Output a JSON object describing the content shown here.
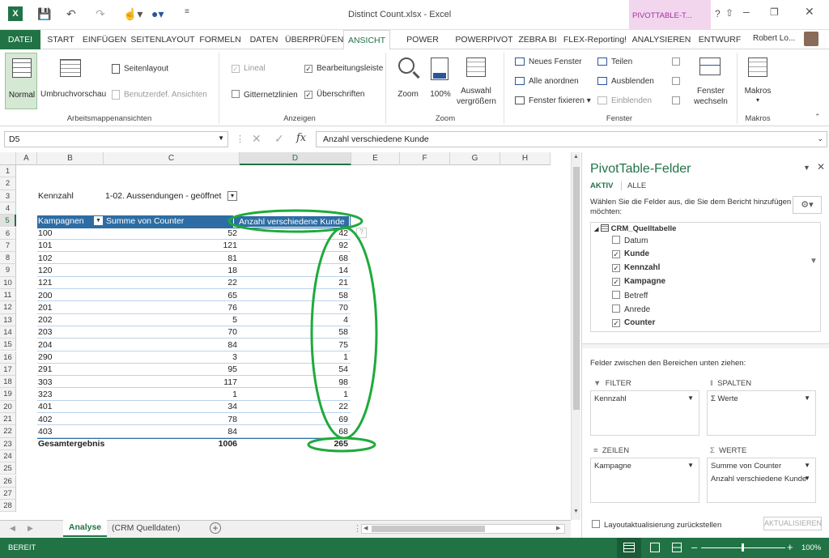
{
  "window": {
    "title": "Distinct Count.xlsx - Excel",
    "context_tab_title": "PIVOTTABLE-T...",
    "user": "Robert Lo..."
  },
  "tabs": [
    "DATEI",
    "START",
    "EINFÜGEN",
    "SEITENLAYOUT",
    "FORMELN",
    "DATEN",
    "ÜBERPRÜFEN",
    "ANSICHT",
    "POWER QUERY",
    "POWERPIVOT",
    "ZEBRA BI",
    "FLEX-Reporting!",
    "ANALYSIEREN",
    "ENTWURF"
  ],
  "ribbon": {
    "workbook_views": {
      "normal": "Normal",
      "page_break": "Umbruchvorschau",
      "page_layout": "Seitenlayout",
      "custom_views": "Benutzerdef. Ansichten",
      "label": "Arbeitsmappenansichten"
    },
    "show": {
      "ruler": "Lineal",
      "formula_bar": "Bearbeitungsleiste",
      "gridlines": "Gitternetzlinien",
      "headings": "Überschriften",
      "label": "Anzeigen"
    },
    "zoom": {
      "zoom": "Zoom",
      "hundred": "100%",
      "selection_line1": "Auswahl",
      "selection_line2": "vergrößern",
      "label": "Zoom"
    },
    "window": {
      "new": "Neues Fenster",
      "arrange": "Alle anordnen",
      "freeze": "Fenster fixieren",
      "split": "Teilen",
      "hide": "Ausblenden",
      "unhide": "Einblenden",
      "switch_line1": "Fenster",
      "switch_line2": "wechseln",
      "label": "Fenster"
    },
    "macros": {
      "macros": "Makros",
      "label": "Makros"
    }
  },
  "formula_bar": {
    "name_box": "D5",
    "fx": "fx",
    "value": "Anzahl verschiedene Kunde"
  },
  "columns": [
    "A",
    "B",
    "C",
    "D",
    "E",
    "F",
    "G",
    "H"
  ],
  "rows": [
    "1",
    "2",
    "3",
    "4",
    "5",
    "6",
    "7",
    "8",
    "9",
    "10",
    "11",
    "12",
    "13",
    "14",
    "15",
    "16",
    "17",
    "18",
    "19",
    "20",
    "21",
    "22",
    "23",
    "24",
    "25",
    "26",
    "27",
    "28"
  ],
  "sheet": {
    "filter_label": "Kennzahl",
    "filter_value": "1-02. Aussendungen - geöffnet",
    "headers": {
      "campaign": "Kampagnen",
      "sum": "Summe von Counter",
      "distinct": "Anzahl verschiedene Kunde"
    },
    "rows": [
      {
        "c": "100",
        "s": "52",
        "d": "42"
      },
      {
        "c": "101",
        "s": "121",
        "d": "92"
      },
      {
        "c": "102",
        "s": "81",
        "d": "68"
      },
      {
        "c": "120",
        "s": "18",
        "d": "14"
      },
      {
        "c": "121",
        "s": "22",
        "d": "21"
      },
      {
        "c": "200",
        "s": "65",
        "d": "58"
      },
      {
        "c": "201",
        "s": "76",
        "d": "70"
      },
      {
        "c": "202",
        "s": "5",
        "d": "4"
      },
      {
        "c": "203",
        "s": "70",
        "d": "58"
      },
      {
        "c": "204",
        "s": "84",
        "d": "75"
      },
      {
        "c": "290",
        "s": "3",
        "d": "1"
      },
      {
        "c": "291",
        "s": "95",
        "d": "54"
      },
      {
        "c": "303",
        "s": "117",
        "d": "98"
      },
      {
        "c": "323",
        "s": "1",
        "d": "1"
      },
      {
        "c": "401",
        "s": "34",
        "d": "22"
      },
      {
        "c": "402",
        "s": "78",
        "d": "69"
      },
      {
        "c": "403",
        "s": "84",
        "d": "68"
      }
    ],
    "total": {
      "label": "Gesamtergebnis",
      "s": "1006",
      "d": "265"
    }
  },
  "sheet_tabs": {
    "active": "Analyse",
    "other": "(CRM Quelldaten)"
  },
  "pane": {
    "title": "PivotTable-Felder",
    "tab_active": "AKTIV",
    "tab_all": "ALLE",
    "instruction": "Wählen Sie die Felder aus, die Sie dem Bericht hinzufügen möchten:",
    "table_name": "CRM_Quelltabelle",
    "fields": [
      {
        "name": "Datum",
        "checked": false
      },
      {
        "name": "Kunde",
        "checked": true
      },
      {
        "name": "Kennzahl",
        "checked": true
      },
      {
        "name": "Kampagne",
        "checked": true
      },
      {
        "name": "Betreff",
        "checked": false
      },
      {
        "name": "Anrede",
        "checked": false
      },
      {
        "name": "Counter",
        "checked": true
      }
    ],
    "drag_hint": "Felder zwischen den Bereichen unten ziehen:",
    "filter_head": "FILTER",
    "columns_head": "SPALTEN",
    "rows_head": "ZEILEN",
    "values_head": "WERTE",
    "filter_item": "Kennzahl",
    "columns_item": "Σ Werte",
    "rows_item": "Kampagne",
    "values_items": [
      "Summe von Counter",
      "Anzahl verschiedene Kunde"
    ],
    "defer": "Layoutaktualisierung zurückstellen",
    "update": "AKTUALISIEREN"
  },
  "status": {
    "ready": "BEREIT",
    "zoom": "100%"
  },
  "colors": {
    "excel_green": "#217346",
    "pivot_header": "#2e6da4",
    "annotation_green": "#1faa3c",
    "context_pink": "#f2d6ee"
  }
}
